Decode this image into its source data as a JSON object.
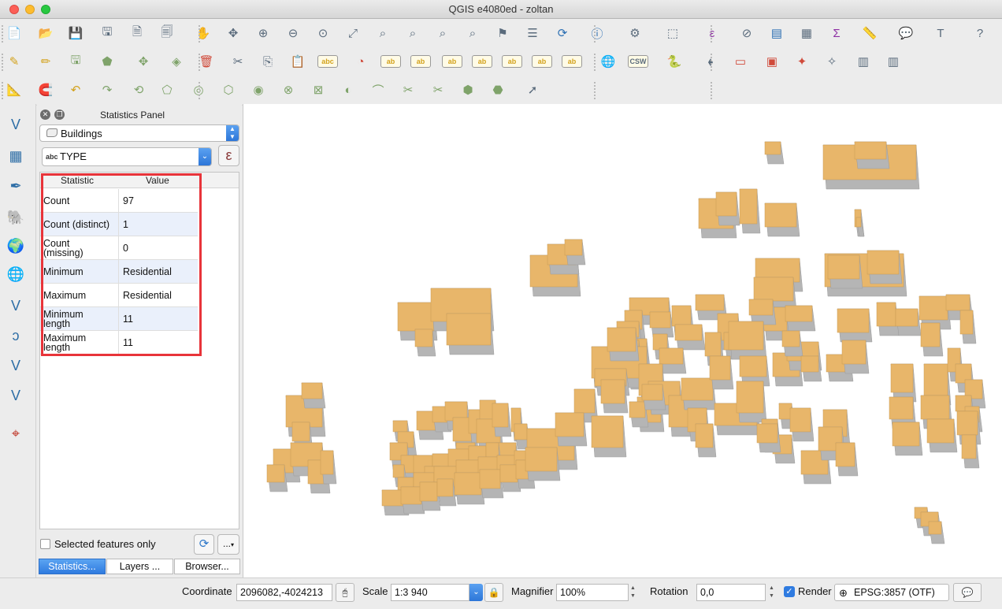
{
  "window": {
    "title": "QGIS e4080ed - zoltan"
  },
  "icons": {
    "toolbar1": [
      "new-project-icon",
      "open-project-icon",
      "save-project-icon",
      "save-as-icon",
      "new-print-layout-icon",
      "layout-manager-icon",
      "pan-icon",
      "pan-to-selection-icon",
      "zoom-in-icon",
      "zoom-out-icon",
      "zoom-native-icon",
      "zoom-full-icon",
      "zoom-to-selection-icon",
      "zoom-to-layer-icon",
      "zoom-last-icon",
      "zoom-next-icon",
      "new-bookmark-icon",
      "show-bookmarks-icon",
      "refresh-icon",
      "identify-icon",
      "action-icon",
      "select-feature-icon",
      "expression-select-icon",
      "deselect-icon",
      "attribute-table-icon",
      "field-calculator-icon",
      "statistics-sum-icon",
      "measure-icon",
      "map-tips-icon",
      "text-annotation-icon",
      "help-icon"
    ],
    "toolbar2": [
      "current-edits-icon",
      "toggle-editing-icon",
      "save-edits-icon",
      "add-feature-icon",
      "move-feature-icon",
      "node-tool-icon",
      "delete-selected-icon",
      "cut-features-icon",
      "copy-features-icon",
      "paste-features-icon",
      "label-icon",
      "diagram-icon",
      "layer-labeling-icon",
      "pin-labels-icon",
      "highlight-pinned-icon",
      "show-hide-labels-icon",
      "move-label-icon",
      "rotate-label-icon",
      "change-label-icon",
      "add-wms-icon",
      "add-csw-icon",
      "python-console-icon",
      "georeferencer-icon",
      "select-rectangle-icon",
      "select-box-icon",
      "magic-wand-icon",
      "magic-wand-2-icon",
      "table-icon",
      "table-2-icon"
    ],
    "toolbar3": [
      "digitize-icon",
      "snapping-icon",
      "undo-icon",
      "redo-icon",
      "rotate-feature-icon",
      "simplify-icon",
      "add-ring-icon",
      "add-part-icon",
      "fill-ring-icon",
      "delete-ring-icon",
      "delete-part-icon",
      "reshape-icon",
      "offset-curve-icon",
      "split-features-icon",
      "split-parts-icon",
      "merge-features-icon",
      "merge-attributes-icon",
      "rotate-point-symbols-icon"
    ],
    "left": [
      "add-vector-icon",
      "add-raster-icon",
      "add-delimited-text-icon",
      "add-postgis-icon",
      "add-spatialite-icon",
      "add-wms-layer-icon",
      "add-wfs-icon",
      "add-virtual-icon",
      "add-oracle-icon",
      "new-shapefile-icon",
      "add-geonode-icon"
    ]
  },
  "statistics_panel": {
    "title": "Statistics Panel",
    "layer": "Buildings",
    "field_type": "abc",
    "field": "TYPE",
    "expression_symbol": "ε",
    "headers": {
      "statistic": "Statistic",
      "value": "Value"
    },
    "rows": [
      {
        "statistic": "Count",
        "value": "97"
      },
      {
        "statistic": "Count (distinct)",
        "value": "1"
      },
      {
        "statistic": "Count\n(missing)",
        "value": "0"
      },
      {
        "statistic": "Minimum",
        "value": "Residential"
      },
      {
        "statistic": "Maximum",
        "value": "Residential"
      },
      {
        "statistic": "Minimum\nlength",
        "value": "11"
      },
      {
        "statistic": "Maximum\nlength",
        "value": "11"
      }
    ],
    "selected_only_label": "Selected features only",
    "more_label": "...",
    "tabs": [
      "Statistics...",
      "Layers ...",
      "Browser..."
    ]
  },
  "statusbar": {
    "coordinate_label": "Coordinate",
    "coordinate_value": "2096082,-4024213",
    "scale_label": "Scale",
    "scale_value": "1:3 940",
    "magnifier_label": "Magnifier",
    "magnifier_value": "100%",
    "rotation_label": "Rotation",
    "rotation_value": "0,0",
    "render_label": "Render",
    "crs_label": "EPSG:3857 (OTF)"
  },
  "colors": {
    "building_fill": "#e8b66a",
    "building_side": "#b5b5b5",
    "highlight": "#e8343a",
    "accent": "#2f7be0"
  }
}
